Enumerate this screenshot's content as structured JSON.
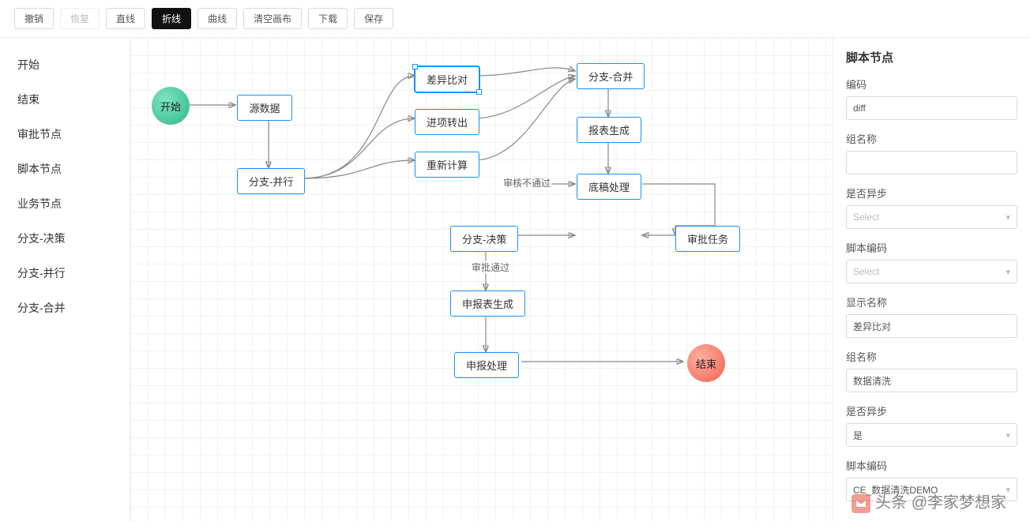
{
  "toolbar": {
    "undo": "撤销",
    "redo": "恢复",
    "straight": "直线",
    "polyline": "折线",
    "curve": "曲线",
    "clear": "清空画布",
    "download": "下载",
    "save": "保存"
  },
  "sidebar": {
    "items": [
      "开始",
      "结束",
      "审批节点",
      "脚本节点",
      "业务节点",
      "分支-决策",
      "分支-并行",
      "分支-合并"
    ]
  },
  "nodes": {
    "start": "开始",
    "source": "源数据",
    "branch_parallel": "分支-并行",
    "diff": "差异比对",
    "export": "进项转出",
    "recalc": "重新计算",
    "branch_merge": "分支-合并",
    "report_gen": "报表生成",
    "draft_handle": "底稿处理",
    "branch_decision": "分支-决策",
    "audit_task": "审批任务",
    "declare_gen": "申报表生成",
    "declare_handle": "申报处理",
    "end": "结束"
  },
  "edge_labels": {
    "fail": "审核不通过",
    "pass": "审批通过"
  },
  "props": {
    "title": "脚本节点",
    "code_label": "编码",
    "code_value": "diff",
    "group_label": "组名称",
    "group_value": "",
    "async_label": "是否异步",
    "async_value": "Select",
    "script_code_label": "脚本编码",
    "script_code_value": "Select",
    "display_label": "显示名称",
    "display_value": "差异比对",
    "group2_label": "组名称",
    "group2_value": "数据清洗",
    "async2_label": "是否异步",
    "async2_value": "是",
    "script_code2_label": "脚本编码",
    "script_code2_value": "CE_数据清洗DEMO"
  },
  "watermark": "头条 @李家梦想家"
}
